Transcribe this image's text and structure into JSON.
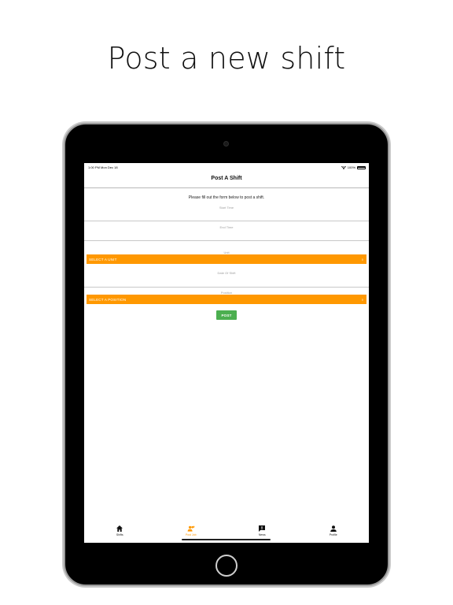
{
  "headline": "Post a new shift",
  "status_bar": {
    "time": "1:00 PM   Mon Dec 18",
    "battery": "100%"
  },
  "nav": {
    "title": "Post A Shift"
  },
  "form": {
    "intro": "Please fill out the form below to post a shift.",
    "start_time_label": "Start Time",
    "end_time_label": "End Time",
    "unit_label": "Unit",
    "unit_select": "SELECT A UNIT",
    "date_label": "Date Of Shift",
    "position_label": "Position",
    "position_select": "SELECT A POSITION",
    "dropdown_glyph": "◊",
    "post_button": "POST"
  },
  "tabs": [
    {
      "label": "Shifts",
      "icon": "home-icon",
      "active": false
    },
    {
      "label": "Post Job",
      "icon": "people-add-icon",
      "active": true
    },
    {
      "label": "News",
      "icon": "news-alert-icon",
      "active": false
    },
    {
      "label": "Profile",
      "icon": "person-icon",
      "active": false
    }
  ],
  "colors": {
    "accent": "#ff9800",
    "post_button": "#4caf50",
    "device": "#000000"
  }
}
